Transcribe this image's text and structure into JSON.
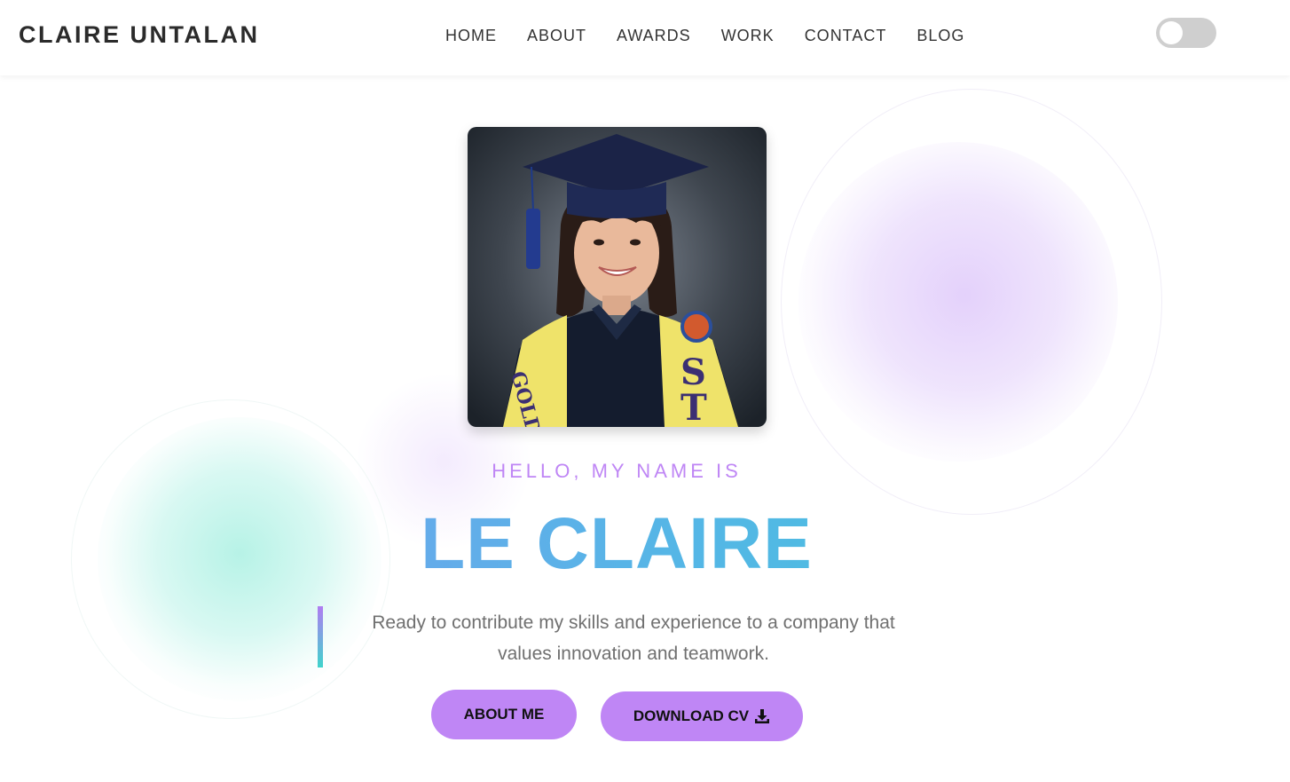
{
  "header": {
    "logo": "CLAIRE UNTALAN",
    "nav": [
      "HOME",
      "ABOUT",
      "AWARDS",
      "WORK",
      "CONTACT",
      "BLOG"
    ],
    "theme_toggle": "off"
  },
  "hero": {
    "photo_icon": "graduation-portrait",
    "greeting": "HELLO, MY NAME IS",
    "name": "LE CLAIRE",
    "tagline_line1": "Ready to contribute my skills and experience to a company that",
    "tagline_line2": "values innovation and teamwork.",
    "buttons": {
      "about": "ABOUT ME",
      "cv": "DOWNLOAD CV",
      "cv_icon": "download-icon"
    }
  },
  "colors": {
    "accent": "#bf86f5",
    "name_gradient_start": "#7c9af0",
    "name_gradient_end": "#3fc6d8",
    "toggle_bg": "#cfcfcf"
  }
}
